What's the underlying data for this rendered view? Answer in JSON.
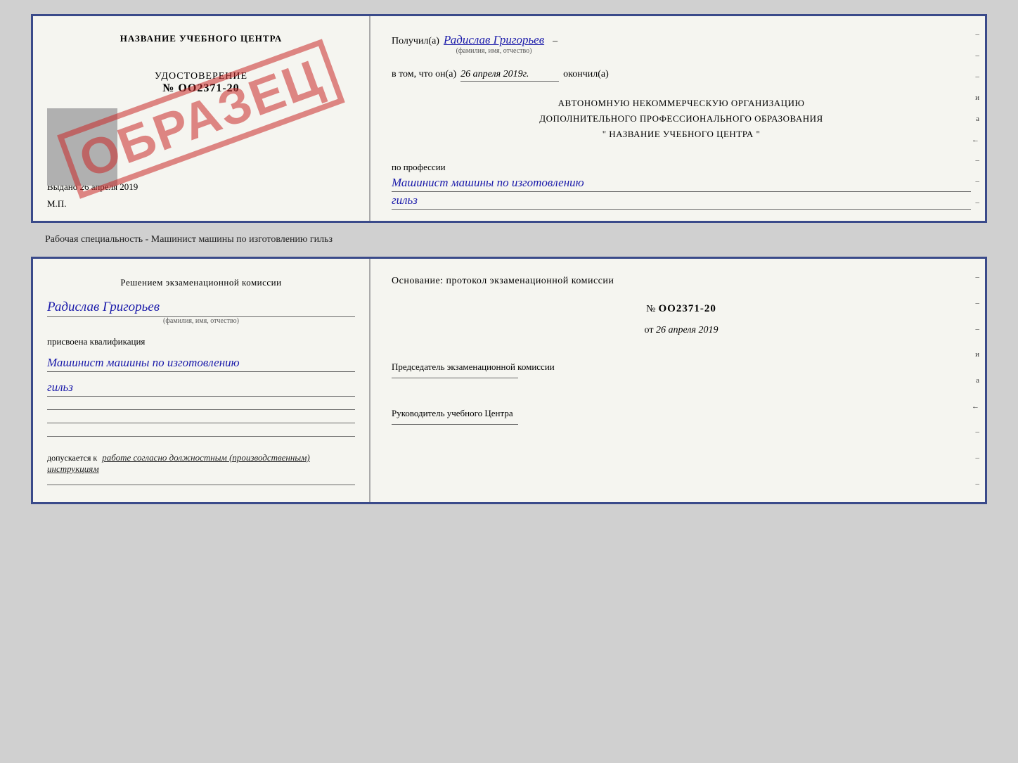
{
  "top_document": {
    "left": {
      "center_title": "НАЗВАНИЕ УЧЕБНОГО ЦЕНТРА",
      "cert_label": "УДОСТОВЕРЕНИЕ",
      "cert_number": "№ OO2371-20",
      "stamp": "ОБРАЗЕЦ",
      "issued_label": "Выдано",
      "issued_date": "26 апреля 2019",
      "mp_label": "М.П."
    },
    "right": {
      "received_label": "Получил(а)",
      "received_value": "Радислав Григорьев",
      "received_sub": "(фамилия, имя, отчество)",
      "dash": "–",
      "in_that_label": "в том, что он(а)",
      "in_that_value": "26 апреля 2019г.",
      "finished_label": "окончил(а)",
      "org_line1": "АВТОНОМНУЮ НЕКОММЕРЧЕСКУЮ ОРГАНИЗАЦИЮ",
      "org_line2": "ДОПОЛНИТЕЛЬНОГО ПРОФЕССИОНАЛЬНОГО ОБРАЗОВАНИЯ",
      "org_line3": "\" НАЗВАНИЕ УЧЕБНОГО ЦЕНТРА \"",
      "profession_label": "по профессии",
      "profession_value_line1": "Машинист машины по изготовлению",
      "profession_value_line2": "гильз",
      "side_marks": [
        "–",
        "–",
        "–",
        "и",
        "а",
        "←",
        "–",
        "–",
        "–"
      ]
    }
  },
  "caption": "Рабочая специальность - Машинист машины по изготовлению гильз",
  "bottom_document": {
    "left": {
      "decision_title": "Решением  экзаменационной  комиссии",
      "name_value": "Радислав Григорьев",
      "name_sub": "(фамилия, имя, отчество)",
      "assigned_label": "присвоена квалификация",
      "profession_line1": "Машинист машины по изготовлению",
      "profession_line2": "гильз",
      "line1": "",
      "line2": "",
      "line3": "",
      "allowed_label": "допускается к",
      "allowed_value": "работе согласно должностным (производственным) инструкциям"
    },
    "right": {
      "osnov_label": "Основание: протокол экзаменационной комиссии",
      "number_label": "№",
      "number_value": "OO2371-20",
      "date_prefix": "от",
      "date_value": "26 апреля 2019",
      "chairman_label": "Председатель экзаменационной комиссии",
      "head_label": "Руководитель учебного Центра",
      "side_marks": [
        "–",
        "–",
        "–",
        "и",
        "а",
        "←",
        "–",
        "–",
        "–"
      ]
    }
  }
}
